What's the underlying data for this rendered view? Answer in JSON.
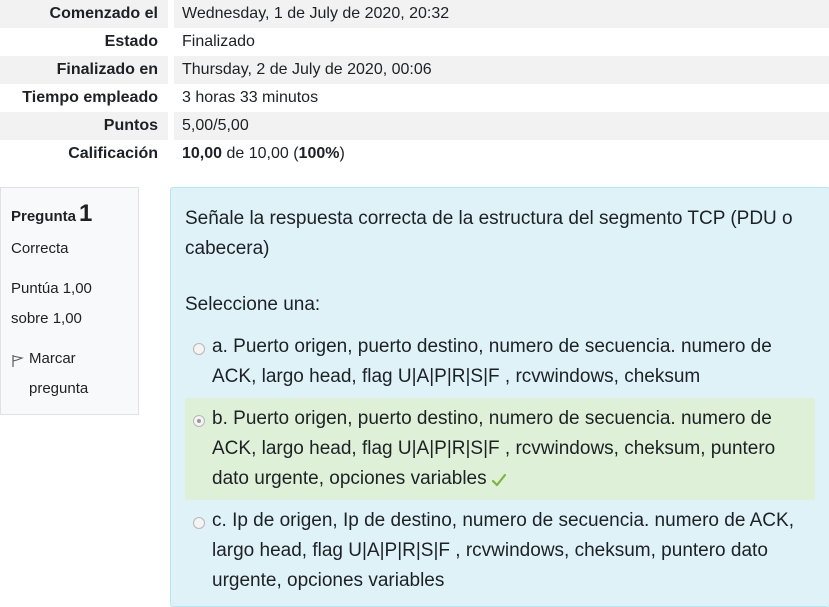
{
  "summary": {
    "rows": [
      {
        "label": "Comenzado el",
        "value": "Wednesday, 1 de July de 2020, 20:32"
      },
      {
        "label": "Estado",
        "value": "Finalizado"
      },
      {
        "label": "Finalizado en",
        "value": "Thursday, 2 de July de 2020, 00:06"
      },
      {
        "label": "Tiempo empleado",
        "value": "3 horas 33 minutos"
      },
      {
        "label": "Puntos",
        "value": "5,00/5,00"
      }
    ],
    "grade": {
      "label": "Calificación",
      "score": "10,00",
      "of_text": " de 10,00 (",
      "percent": "100%",
      "close": ")"
    }
  },
  "question_info": {
    "label": "Pregunta",
    "number": "1",
    "state": "Correcta",
    "grade_line1": "Puntúa 1,00",
    "grade_line2": "sobre 1,00",
    "flag_line1": "Marcar",
    "flag_line2": "pregunta",
    "flag_icon": "flag-icon"
  },
  "question": {
    "text": "Señale la respuesta correcta de la estructura del segmento TCP (PDU o cabecera)",
    "prompt": "Seleccione una:",
    "answers": [
      {
        "letter": "a.",
        "text": "Puerto origen, puerto destino, numero de secuencia. numero de ACK, largo head, flag U|A|P|R|S|F , rcvwindows, cheksum",
        "selected": false
      },
      {
        "letter": "b.",
        "text": "Puerto origen, puerto destino, numero de secuencia. numero de ACK, largo head, flag U|A|P|R|S|F , rcvwindows, cheksum, puntero dato urgente, opciones variables",
        "selected": true
      },
      {
        "letter": "c.",
        "text": "Ip de origen, Ip de destino, numero de secuencia. numero de ACK, largo head, flag U|A|P|R|S|F , rcvwindows, cheksum, puntero dato urgente, opciones variables",
        "selected": false
      }
    ],
    "correct_icon": "check-icon",
    "correct_color": "#7cb342"
  }
}
